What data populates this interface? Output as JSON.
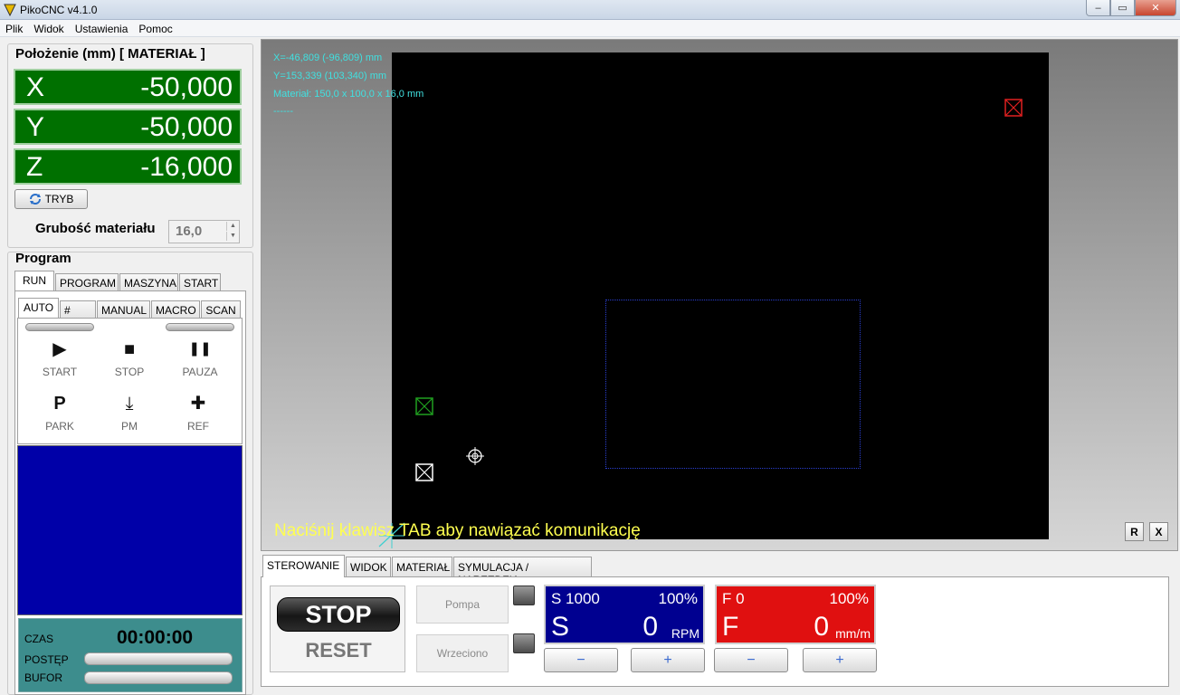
{
  "window": {
    "title": "PikoCNC v4.1.0",
    "min": "–",
    "max": "▭",
    "close": "✕"
  },
  "menu": [
    "Plik",
    "Widok",
    "Ustawienia",
    "Pomoc"
  ],
  "position": {
    "title": "Położenie (mm) [ MATERIAŁ ]",
    "axes": [
      {
        "name": "X",
        "value": "-50,000"
      },
      {
        "name": "Y",
        "value": "-50,000"
      },
      {
        "name": "Z",
        "value": "-16,000"
      }
    ],
    "mode_button": "TRYB",
    "thickness_label": "Grubość materiału",
    "thickness_value": "16,0"
  },
  "program": {
    "title": "Program",
    "tabs": [
      "RUN",
      "PROGRAM",
      "MASZYNA",
      "START"
    ],
    "subtabs": [
      "AUTO",
      "#",
      "MANUAL",
      "MACRO",
      "SCAN"
    ],
    "controls": [
      {
        "glyph": "▶",
        "label": "START"
      },
      {
        "glyph": "■",
        "label": "STOP"
      },
      {
        "glyph": "❚❚",
        "label": "PAUZA"
      },
      {
        "glyph": "P",
        "label": "PARK"
      },
      {
        "glyph": "⤓",
        "label": "PM"
      },
      {
        "glyph": "✚",
        "label": "REF"
      }
    ],
    "status": {
      "time_label": "CZAS",
      "time_value": "00:00:00",
      "progress_label": "POSTĘP",
      "buffer_label": "BUFOR"
    }
  },
  "viewport": {
    "coords": [
      "X=-46,809 (-96,809) mm",
      "Y=153,339 (103,340) mm",
      "Materiał: 150,0 x 100,0 x 16,0 mm",
      "------"
    ],
    "hint": "Naciśnij klawisz TAB aby nawiązać komunikację",
    "btn_r": "R",
    "btn_x": "X"
  },
  "bottom": {
    "tabs": [
      "STEROWANIE",
      "WIDOK",
      "MATERIAŁ",
      "SYMULACJA / NARZĘDZIA"
    ],
    "stop_label": "STOP",
    "reset_label": "RESET",
    "pump_label": "Pompa",
    "spindle_label": "Wrzeciono",
    "spindle": {
      "setpoint": "S 1000",
      "percent": "100%",
      "letter": "S",
      "value": "0",
      "unit": "RPM"
    },
    "feed": {
      "setpoint": "F 0",
      "percent": "100%",
      "letter": "F",
      "value": "0",
      "unit": "mm/m"
    },
    "minus": "−",
    "plus": "+"
  },
  "colors": {
    "axis_bg": "#007000",
    "viewport_bg": "#000000",
    "coords": "#40e0e0",
    "hint": "#ffff50",
    "spindle_bg": "#000090",
    "feed_bg": "#e01010"
  }
}
